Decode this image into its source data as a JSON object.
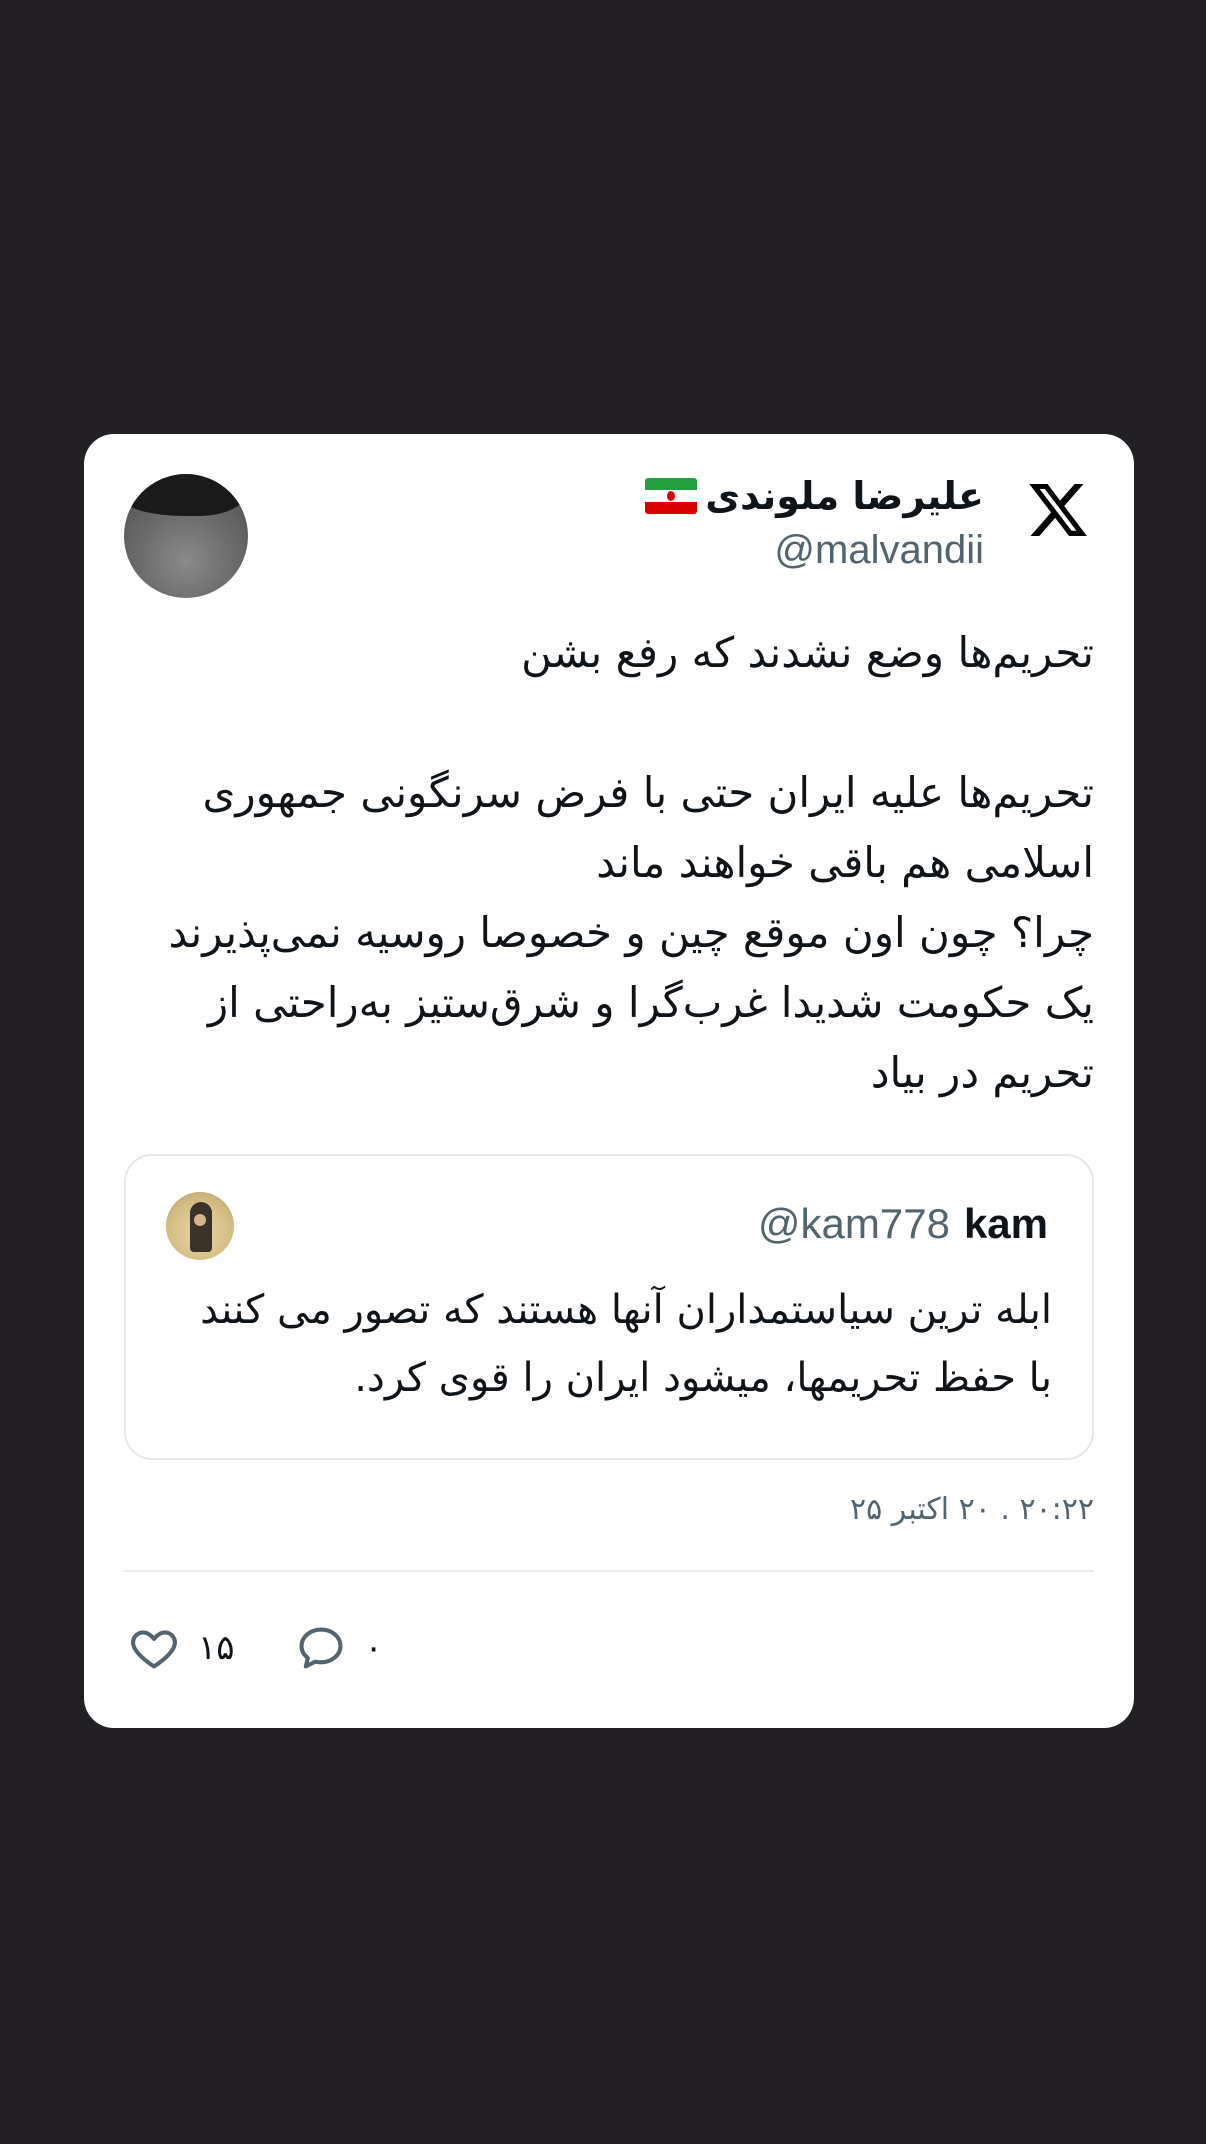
{
  "tweet": {
    "author_name": "علیرضا ملوندی",
    "author_handle": "@malvandii",
    "text": "تحریم‌ها وضع نشدند که رفع بشن\n\nتحریم‌ها علیه ایران حتی با فرض سرنگونی جمهوری اسلامی هم باقی خواهند ماند\nچرا؟ چون اون موقع چین و خصوصا روسیه نمی‌پذیرند یک حکومت شدیدا غرب‌گرا و شرق‌ستیز به‌راحتی از تحریم در بیاد",
    "timestamp": "۲۰:۲۲ . ۲۰ اکتبر ۲۵",
    "likes": "۱۵",
    "replies": "۰"
  },
  "quoted": {
    "name": "kam",
    "handle": "@kam778",
    "text": "ابله ترین سیاستمداران آنها هستند که تصور می کنند با حفظ تحریمها، میشود ایران را قوی کرد."
  },
  "icons": {
    "logo": "x-logo-icon",
    "flag": "iran-flag-icon",
    "like": "heart-icon",
    "reply": "speech-bubble-icon"
  },
  "colors": {
    "background": "#222024",
    "card": "#ffffff",
    "text": "#0f1419",
    "secondary_text": "#536471"
  }
}
